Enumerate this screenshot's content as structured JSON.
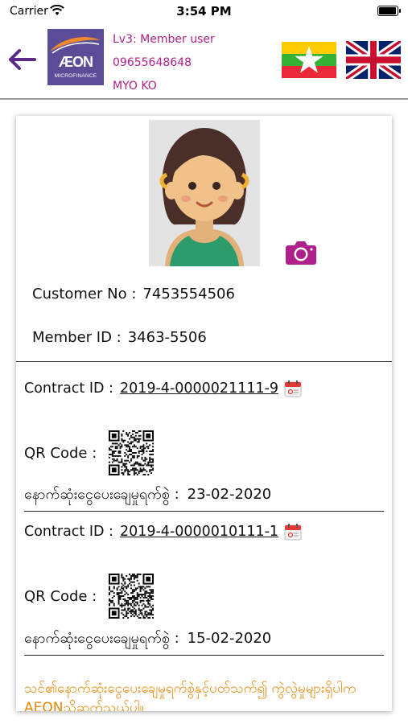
{
  "status_bar": {
    "carrier": "Carrier",
    "time": "3:54 PM",
    "battery_level": 1.0
  },
  "header": {
    "back_icon": "back-arrow-icon",
    "logo": {
      "brand": "ÆON",
      "subtitle": "MICROFINANCE"
    },
    "user": {
      "level": "Lv3: Member user",
      "phone": "09655648648",
      "name": "MYO KO"
    },
    "languages": [
      "myanmar-flag-icon",
      "uk-flag-icon"
    ],
    "accent_color": "#b0208a"
  },
  "profile": {
    "camera_icon": "camera-icon",
    "customer_no_label": "Customer No :",
    "customer_no": "7453554506",
    "member_id_label": "Member ID :",
    "member_id": "3463-5506"
  },
  "contracts": [
    {
      "contract_label": "Contract ID :",
      "contract_id": "2019-4-0000021111-9",
      "qr_label": "QR Code :",
      "last_payment_label": "နောက်ဆုံးငွေပေးချေမှုရက်စွဲ :",
      "last_payment_date": "23-02-2020"
    },
    {
      "contract_label": "Contract ID :",
      "contract_id": "2019-4-0000010111-1",
      "qr_label": "QR Code :",
      "last_payment_label": "နောက်ဆုံးငွေပေးချေမှုရက်စွဲ :",
      "last_payment_date": "15-02-2020"
    }
  ],
  "notice": "သင်၏နောက်ဆုံးငွေပေးချေမှုရက်စွဲနှင့်ပတ်သက်၍ ကွဲလွဲမှုများရှိပါက AEONသို့ဆက်သွယ်ပါ။",
  "notice_color": "#e8890b"
}
